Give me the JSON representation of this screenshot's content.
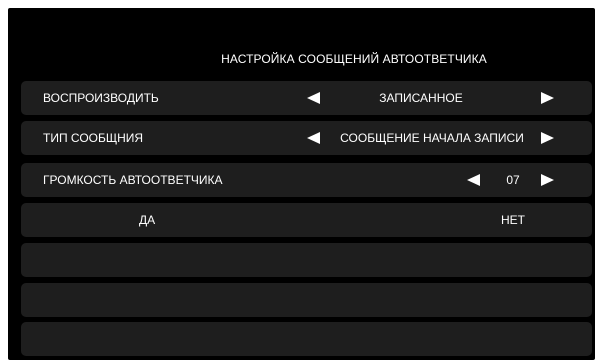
{
  "title": "НАСТРОЙКА СООБЩЕНИЙ АВТООТВЕТЧИКА",
  "rows": [
    {
      "label": "ВОСПРОИЗВОДИТЬ",
      "value": "ЗАПИСАННОЕ"
    },
    {
      "label": "ТИП СООБЩНИЯ",
      "value": "СООБЩЕНИЕ НАЧАЛА ЗАПИСИ"
    },
    {
      "label": "ГРОМКОСТЬ АВТООТВЕТЧИКА",
      "value": "07"
    }
  ],
  "buttons": {
    "yes": "ДА",
    "no": "НЕТ"
  },
  "colors": {
    "background": "#000000",
    "row": "#1e1e1e",
    "text": "#ffffff"
  }
}
